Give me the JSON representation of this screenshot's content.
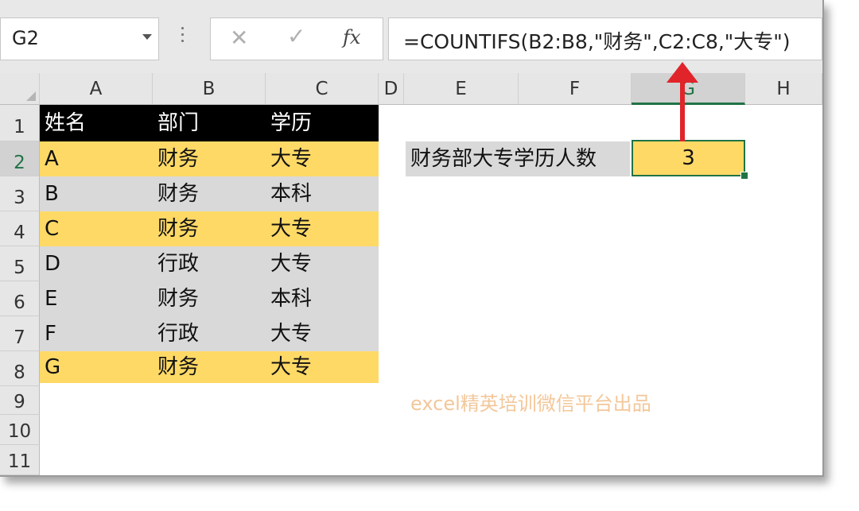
{
  "namebox": {
    "value": "G2"
  },
  "formula_bar": {
    "cancel_icon": "✕",
    "enter_icon": "✓",
    "fx_label": "fx",
    "formula": "=COUNTIFS(B2:B8,\"财务\",C2:C8,\"大专\")"
  },
  "columns": [
    "A",
    "B",
    "C",
    "D",
    "E",
    "F",
    "G",
    "H"
  ],
  "rows": [
    "1",
    "2",
    "3",
    "4",
    "5",
    "6",
    "7",
    "8",
    "9",
    "10",
    "11"
  ],
  "table": {
    "headers": [
      "姓名",
      "部门",
      "学历"
    ],
    "rows": [
      [
        "A",
        "财务",
        "大专"
      ],
      [
        "B",
        "财务",
        "本科"
      ],
      [
        "C",
        "财务",
        "大专"
      ],
      [
        "D",
        "行政",
        "大专"
      ],
      [
        "E",
        "财务",
        "本科"
      ],
      [
        "F",
        "行政",
        "大专"
      ],
      [
        "G",
        "财务",
        "大专"
      ]
    ]
  },
  "result": {
    "label": "财务部大专学历人数",
    "value": "3"
  },
  "watermark": "excel精英培训微信平台出品",
  "colors": {
    "highlight_yellow": "#ffd966",
    "row_gray": "#d9d9d9",
    "header_black": "#000000",
    "selection_green": "#217346",
    "arrow_red": "#e0242a"
  }
}
